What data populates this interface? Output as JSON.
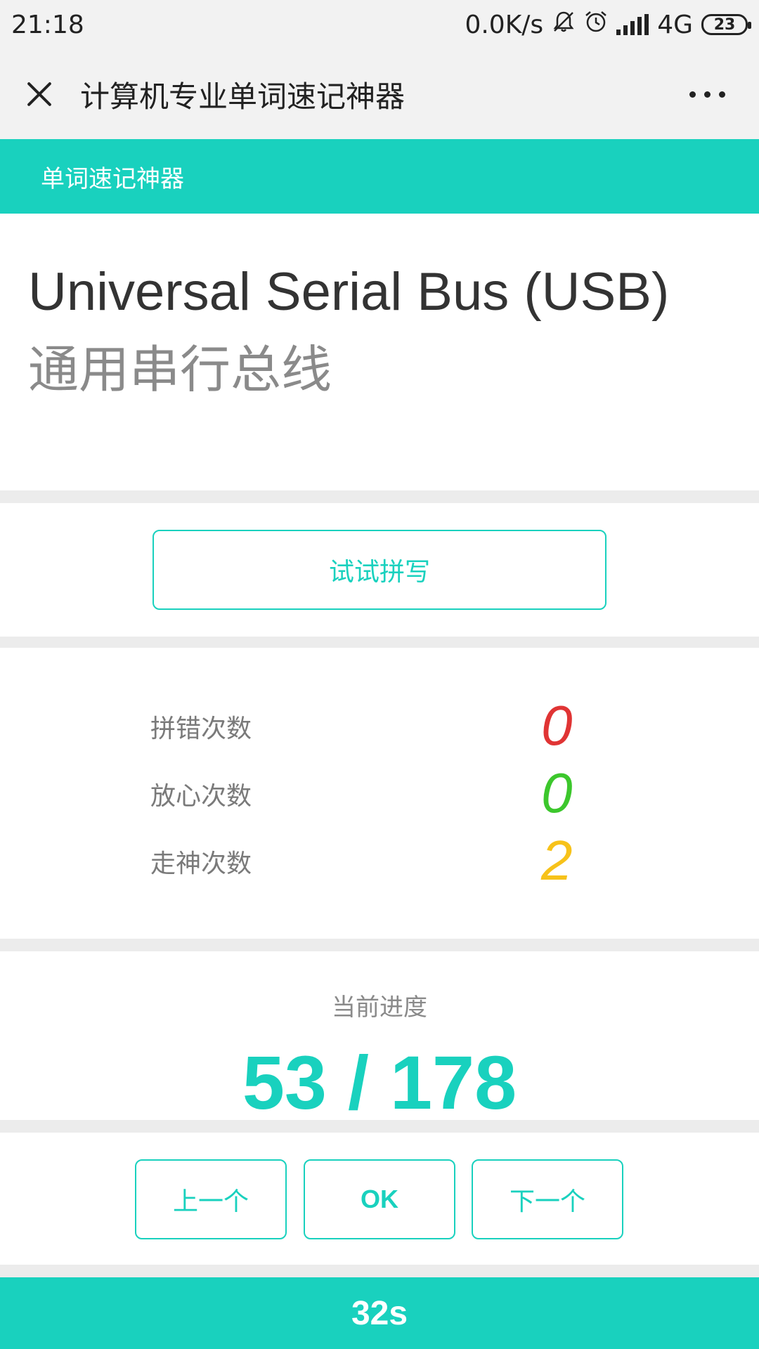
{
  "status_bar": {
    "time": "21:18",
    "network_speed": "0.0K/s",
    "mute_icon": "bell-off-icon",
    "alarm_icon": "alarm-clock-icon",
    "signal_icon": "cellular-signal-icon",
    "network_type": "4G",
    "battery": "23"
  },
  "title_bar": {
    "close_icon": "close-icon",
    "title": "计算机专业单词速记神器",
    "more_icon": "more-dots-icon"
  },
  "header": {
    "title": "单词速记神器",
    "color": "#19d1be"
  },
  "word": {
    "english": "Universal Serial Bus (USB)",
    "chinese": "通用串行总线"
  },
  "spell": {
    "button_label": "试试拼写"
  },
  "stats": [
    {
      "label": "拼错次数",
      "value": "0",
      "color": "#e03434"
    },
    {
      "label": "放心次数",
      "value": "0",
      "color": "#3cc72c"
    },
    {
      "label": "走神次数",
      "value": "2",
      "color": "#f7c21a"
    }
  ],
  "progress": {
    "label": "当前进度",
    "value": "53 / 178"
  },
  "nav": {
    "prev_label": "上一个",
    "ok_label": "OK",
    "next_label": "下一个"
  },
  "timer": {
    "value": "32s"
  }
}
